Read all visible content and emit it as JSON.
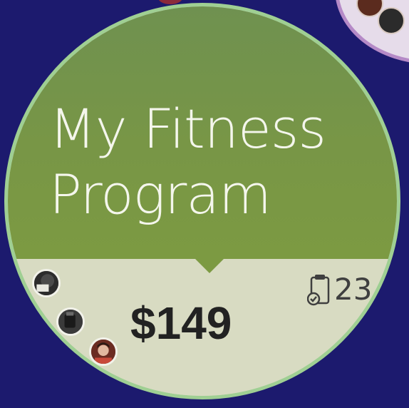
{
  "program_card": {
    "title": "My Fitness Program",
    "price": "$149",
    "count": "23",
    "icons": {
      "count_icon": "clipboard-check-icon",
      "avatars": [
        "member-avatar",
        "member-avatar",
        "member-avatar"
      ]
    },
    "colors": {
      "background": "#1c1a6e",
      "bubble_top": "#789646",
      "bubble_bottom": "#d8dbc2",
      "bubble_border": "#9fcf93",
      "title_text": "#f4f6ec",
      "price_text": "#222222"
    }
  }
}
